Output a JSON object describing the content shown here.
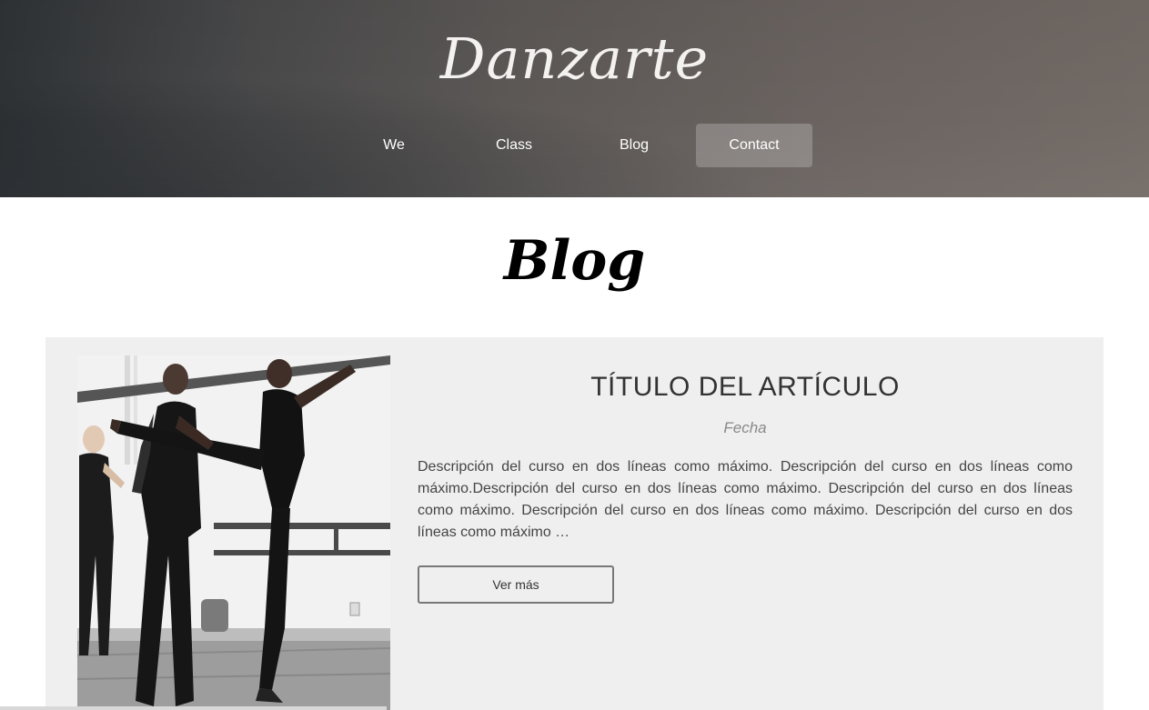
{
  "header": {
    "logo": "Danzarte",
    "nav": [
      {
        "label": "We",
        "active": false
      },
      {
        "label": "Class",
        "active": false
      },
      {
        "label": "Blog",
        "active": false
      },
      {
        "label": "Contact",
        "active": true
      }
    ]
  },
  "main": {
    "section_title": "Blog",
    "article": {
      "title": "TÍTULO DEL ARTÍCULO",
      "date": "Fecha",
      "description": "Descripción del curso en dos líneas como máximo. Descripción del curso en dos líneas como máximo.Descripción del curso en dos líneas como máximo. Descripción del curso en dos líneas como máximo. Descripción del curso en dos líneas como máximo. Descripción del curso en dos líneas como máximo …",
      "button_label": "Ver más"
    }
  },
  "colors": {
    "card_background": "#efefef",
    "active_nav": "rgba(255,255,255,0.22)"
  }
}
